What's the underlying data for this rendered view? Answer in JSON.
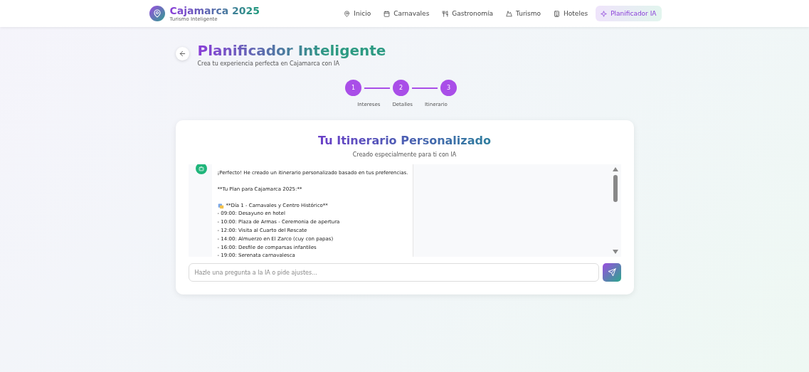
{
  "header": {
    "brand": "Cajamarca 2025",
    "tagline": "Turismo Inteligente",
    "nav": [
      {
        "label": "Inicio",
        "selected": false
      },
      {
        "label": "Carnavales",
        "selected": false
      },
      {
        "label": "Gastronomía",
        "selected": false
      },
      {
        "label": "Turismo",
        "selected": false
      },
      {
        "label": "Hoteles",
        "selected": false
      },
      {
        "label": "Planificador IA",
        "selected": true
      }
    ]
  },
  "page": {
    "title": "Planificador Inteligente",
    "subtitle": "Crea tu experiencia perfecta en Cajamarca con IA"
  },
  "steps": [
    {
      "number": "1",
      "label": "Intereses",
      "done": true
    },
    {
      "number": "2",
      "label": "Detalles",
      "done": true
    },
    {
      "number": "3",
      "label": "Itinerario",
      "done": true
    }
  ],
  "card": {
    "title": "Tu Itinerario Personalizado",
    "subtitle": "Creado especialmente para ti con IA",
    "message": [
      {
        "kind": "text",
        "lines": [
          "¡Perfecto! He creado un itinerario personalizado basado en tus preferencias."
        ]
      },
      {
        "kind": "text",
        "lines": [
          "**Tu Plan para Cajamarca 2025:**"
        ]
      },
      {
        "kind": "day",
        "lines": [
          "**Día 1 - Carnavales y Centro Histórico**",
          "- 09:00: Desayuno en hotel",
          "- 10:00: Plaza de Armas - Ceremonia de apertura",
          "- 12:00: Visita al Cuarto del Rescate",
          "- 14:00: Almuerzo en El Zarco (cuy con papas)",
          "- 16:00: Desfile de comparsas infantiles",
          "- 19:00: Serenata carnavalesca"
        ]
      }
    ],
    "input": {
      "placeholder": "Hazle una pregunta a la IA o pide ajustes..."
    }
  }
}
